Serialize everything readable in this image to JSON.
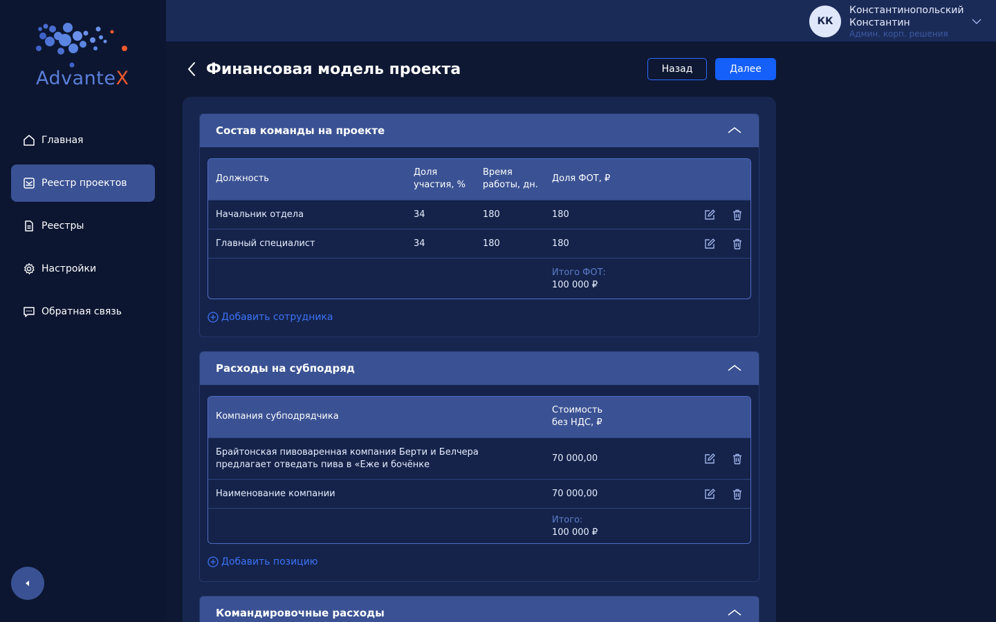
{
  "app": {
    "brand_name": "AdvanteX",
    "brand_prefix": "Advante",
    "brand_suffix": "X",
    "brand_color": "#5b7fd9",
    "accent_color": "#f15a2b",
    "primary_button_color": "#1560fb"
  },
  "sidebar": {
    "items": [
      {
        "label": "Главная",
        "icon": "home-icon",
        "active": false
      },
      {
        "label": "Реестр проектов",
        "icon": "project-registry-icon",
        "active": true
      },
      {
        "label": "Реестры",
        "icon": "document-icon",
        "active": false
      },
      {
        "label": "Настройки",
        "icon": "gear-icon",
        "active": false
      },
      {
        "label": "Обратная связь",
        "icon": "chat-icon",
        "active": false
      }
    ],
    "collapse_icon": "caret-left-icon"
  },
  "header": {
    "user": {
      "initials": "КК",
      "name_line1": "Константинопольский",
      "name_line2": "Константин",
      "role": "Админ. корп. решения"
    }
  },
  "page": {
    "title": "Финансовая модель проекта",
    "back_label": "Назад",
    "next_label": "Далее"
  },
  "team": {
    "title": "Состав команды на проекте",
    "columns": [
      "Должность",
      "Доля участия, %",
      "Время работы, дн.",
      "Доля ФОТ, ₽"
    ],
    "col_share_line1": "Доля",
    "col_share_line2": "участия, %",
    "col_time_line1": "Время",
    "col_time_line2": "работы, дн.",
    "rows": [
      {
        "position": "Начальник отдела",
        "share": "34",
        "days": "180",
        "fot": "180"
      },
      {
        "position": "Главный специалист",
        "share": "34",
        "days": "180",
        "fot": "180"
      }
    ],
    "total_label": "Итого ФОТ:",
    "total_value": "100 000 ₽",
    "add_label": "Добавить сотрудника"
  },
  "subcontract": {
    "title": "Расходы на субподряд",
    "col_company": "Компания субподрядчика",
    "col_cost_line1": "Стоимость",
    "col_cost_line2": "без НДС, ₽",
    "rows": [
      {
        "company_line1": "Брайтонская пивоваренная компания Берти и Белчера",
        "company_line2": "предлагает отведать пива в «Еже и бочёнке",
        "cost": "70 000,00"
      },
      {
        "company_line1": "Наименование компании",
        "company_line2": "",
        "cost": "70 000,00"
      }
    ],
    "total_label": "Итого:",
    "total_value": "100 000 ₽",
    "add_label": "Добавить позицию"
  },
  "travel": {
    "title": "Командировочные расходы"
  }
}
